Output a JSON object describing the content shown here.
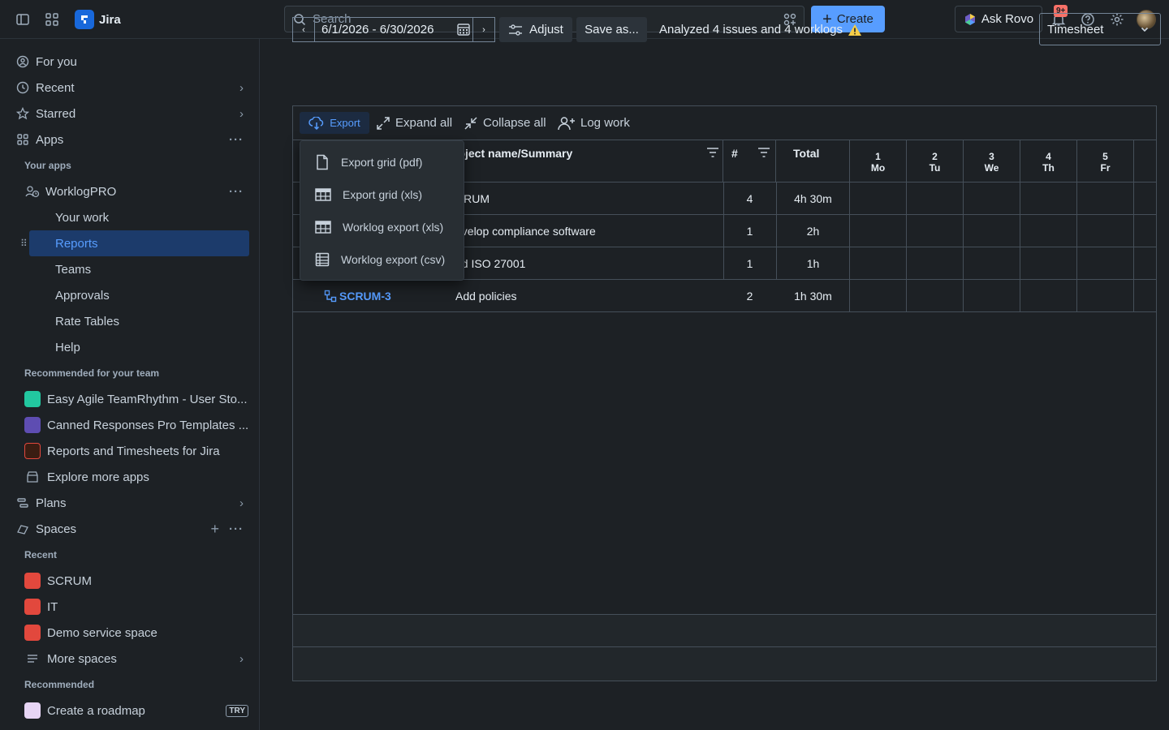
{
  "topbar": {
    "app_name": "Jira",
    "search_placeholder": "Search",
    "create_label": "Create",
    "rovo_label": "Ask Rovo",
    "notif_badge": "9+"
  },
  "sidebar": {
    "for_you": "For you",
    "recent": "Recent",
    "starred": "Starred",
    "apps": "Apps",
    "your_apps_heading": "Your apps",
    "worklogpro": "WorklogPRO",
    "worklog_items": [
      "Your work",
      "Reports",
      "Teams",
      "Approvals",
      "Rate Tables",
      "Help"
    ],
    "recommended_team_heading": "Recommended for your team",
    "recommended_apps": [
      "Easy Agile TeamRhythm - User Sto...",
      "Canned Responses Pro Templates ...",
      "Reports and Timesheets for Jira"
    ],
    "explore_more": "Explore more apps",
    "plans": "Plans",
    "spaces": "Spaces",
    "recent_heading": "Recent",
    "recent_spaces": [
      "SCRUM",
      "IT",
      "Demo service space"
    ],
    "more_spaces": "More spaces",
    "recommended_heading": "Recommended",
    "create_roadmap": "Create a roadmap",
    "try_badge": "TRY"
  },
  "filters": {
    "date_range": "6/1/2026 - 6/30/2026",
    "adjust_label": "Adjust",
    "save_as_label": "Save as...",
    "analyzed_text": "Analyzed 4 issues and 4 worklogs",
    "view_select": "Timesheet"
  },
  "toolbar": {
    "export": "Export",
    "expand_all": "Expand all",
    "collapse_all": "Collapse all",
    "log_work": "Log work"
  },
  "export_menu": [
    "Export grid (pdf)",
    "Export grid (xls)",
    "Worklog export (xls)",
    "Worklog export (csv)"
  ],
  "table": {
    "col_summary": "roject name/Summary",
    "col_count": "#",
    "col_total": "Total",
    "days": [
      {
        "num": "1",
        "dow": "Mo"
      },
      {
        "num": "2",
        "dow": "Tu"
      },
      {
        "num": "3",
        "dow": "We"
      },
      {
        "num": "4",
        "dow": "Th"
      },
      {
        "num": "5",
        "dow": "Fr"
      }
    ],
    "rows": [
      {
        "key": "",
        "summary": "CRUM",
        "count": "4",
        "total": "4h 30m"
      },
      {
        "key": "",
        "summary": "evelop compliance software",
        "count": "1",
        "total": "2h"
      },
      {
        "key": "",
        "summary": "dd ISO 27001",
        "count": "1",
        "total": "1h"
      },
      {
        "key": "SCRUM-3",
        "summary": "Add policies",
        "count": "2",
        "total": "1h 30m"
      }
    ]
  }
}
